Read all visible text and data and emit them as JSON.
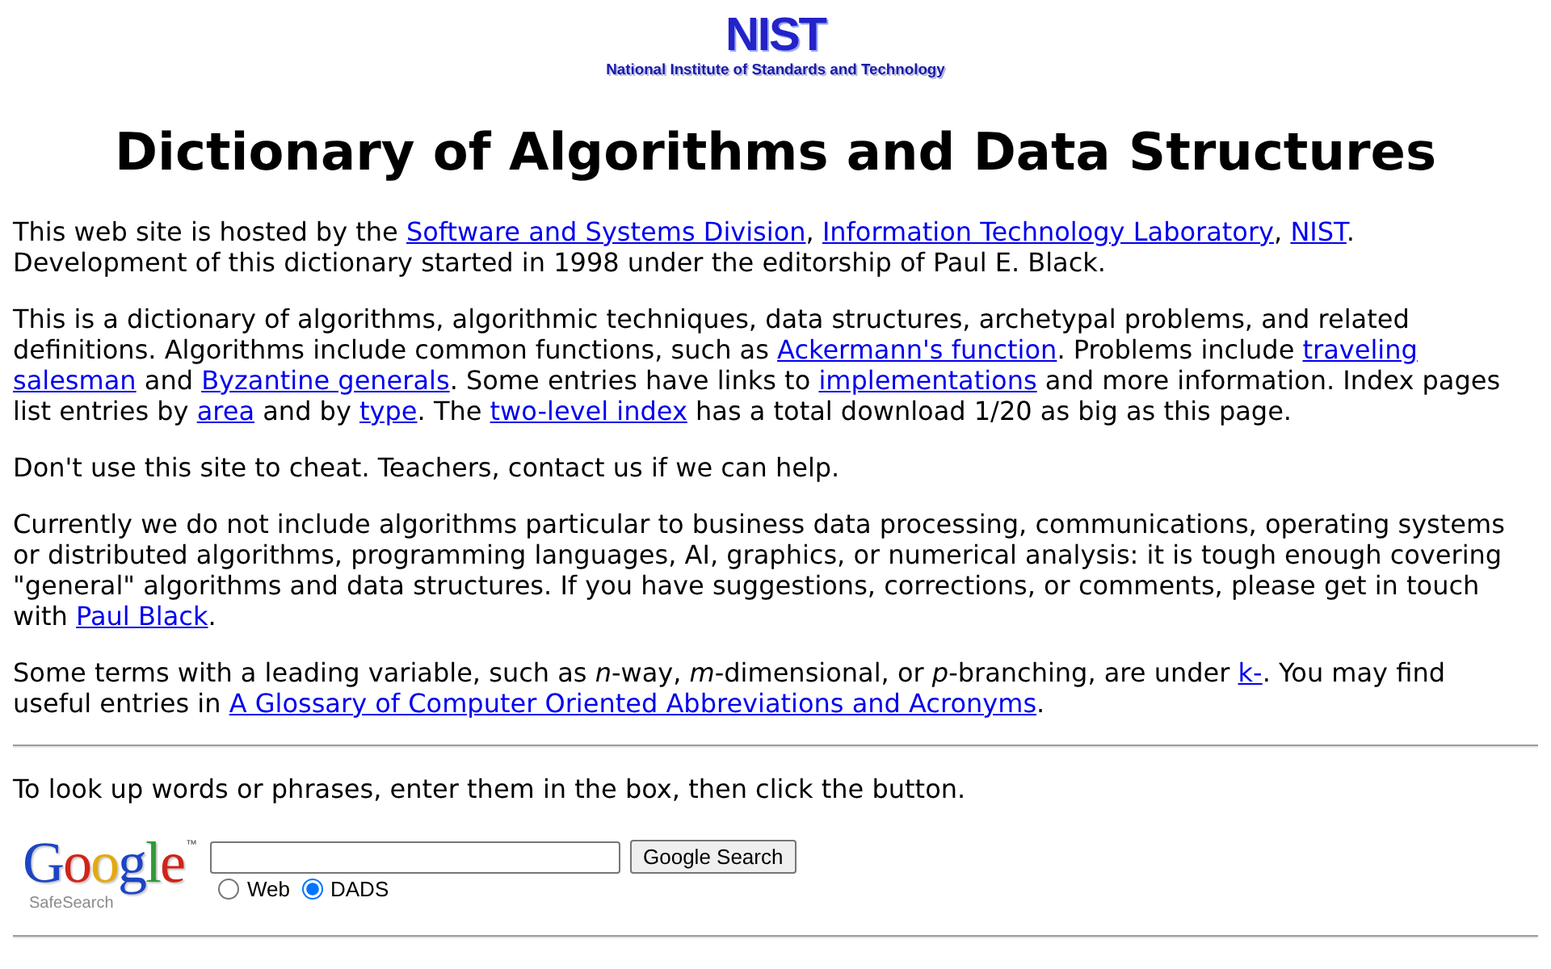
{
  "header": {
    "logo_mark": "NIST",
    "logo_caption": "National Institute of Standards and Technology"
  },
  "title": "Dictionary of Algorithms and Data Structures",
  "paragraphs": [
    {
      "segments": [
        {
          "kind": "text",
          "text": "This web site is hosted by the "
        },
        {
          "kind": "link",
          "text": "Software and Systems Division"
        },
        {
          "kind": "text",
          "text": ", "
        },
        {
          "kind": "link",
          "text": "Information Technology Laboratory"
        },
        {
          "kind": "text",
          "text": ", "
        },
        {
          "kind": "link",
          "text": "NIST"
        },
        {
          "kind": "text",
          "text": ". Development of this dictionary started in 1998 under the editorship of Paul E. Black."
        }
      ]
    },
    {
      "segments": [
        {
          "kind": "text",
          "text": "This is a dictionary of algorithms, algorithmic techniques, data structures, archetypal problems, and related definitions. Algorithms include common functions, such as "
        },
        {
          "kind": "link",
          "text": "Ackermann's function"
        },
        {
          "kind": "text",
          "text": ". Problems include "
        },
        {
          "kind": "link",
          "text": "traveling",
          "space_after": true
        },
        {
          "kind": "link",
          "text": "salesman"
        },
        {
          "kind": "text",
          "text": " and "
        },
        {
          "kind": "link",
          "text": "Byzantine generals"
        },
        {
          "kind": "text",
          "text": ". Some entries have links to "
        },
        {
          "kind": "link",
          "text": "implementations"
        },
        {
          "kind": "text",
          "text": " and more information. Index pages list entries by "
        },
        {
          "kind": "link",
          "text": "area"
        },
        {
          "kind": "text",
          "text": " and by "
        },
        {
          "kind": "link",
          "text": "type"
        },
        {
          "kind": "text",
          "text": ". The "
        },
        {
          "kind": "link",
          "text": "two-level index"
        },
        {
          "kind": "text",
          "text": " has a total download 1/20 as big as this page."
        }
      ]
    },
    {
      "segments": [
        {
          "kind": "text",
          "text": "Don't use this site to cheat. Teachers, contact us if we can help."
        }
      ]
    },
    {
      "segments": [
        {
          "kind": "text",
          "text": "Currently we do not include algorithms particular to business data processing, communications, operating systems or distributed algorithms, programming languages, AI, graphics, or numerical analysis: it is tough enough covering \"general\" algorithms and data structures. If you have suggestions, corrections, or comments, please get in touch with "
        },
        {
          "kind": "link",
          "text": "Paul Black"
        },
        {
          "kind": "text",
          "text": "."
        }
      ]
    },
    {
      "segments": [
        {
          "kind": "text",
          "text": "Some terms with a leading variable, such as *n*-way, *m*-dimensional, or *p*-branching, are under "
        },
        {
          "kind": "link",
          "text": "k-"
        },
        {
          "kind": "text",
          "text": ". You may find useful entries in "
        },
        {
          "kind": "link",
          "text": "A Glossary of Computer Oriented Abbreviations and Acronyms"
        },
        {
          "kind": "text",
          "text": "."
        }
      ]
    }
  ],
  "search": {
    "instruction": "To look up words or phrases, enter them in the box, then click the button.",
    "logo": {
      "wordmark": "Google",
      "trademark": "™",
      "subtitle": "SafeSearch"
    },
    "button": "Google Search",
    "scopes": [
      {
        "label": "Web",
        "selected": false
      },
      {
        "label": "DADS",
        "selected": true
      }
    ]
  }
}
